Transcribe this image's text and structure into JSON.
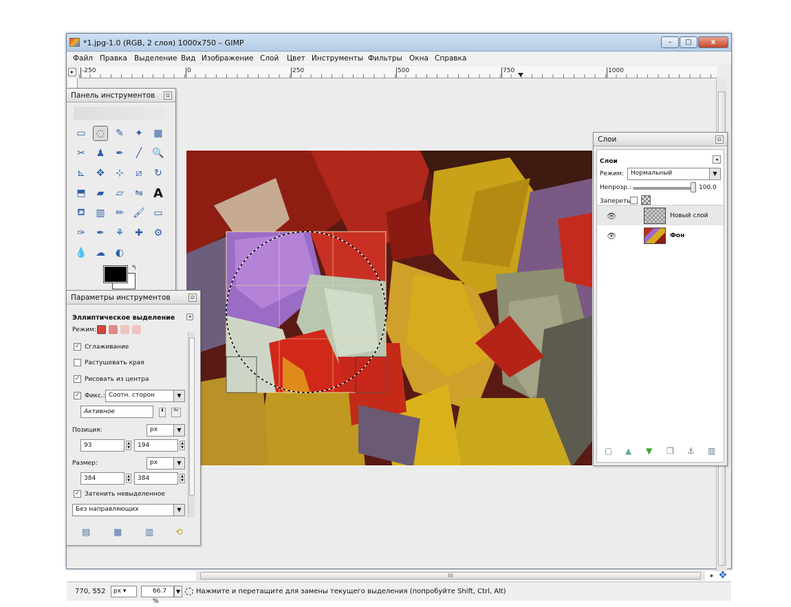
{
  "window": {
    "title": "*1.jpg-1.0 (RGB, 2 слоя) 1000x750 – GIMP",
    "min": "–",
    "max": "□",
    "close": "x"
  },
  "menu": [
    "Файл",
    "Правка",
    "Выделение",
    "Вид",
    "Изображение",
    "Слой",
    "Цвет",
    "Инструменты",
    "Фильтры",
    "Окна",
    "Справка"
  ],
  "ruler": {
    "corner": "▸",
    "labels": [
      "-250",
      "0",
      "250",
      "500",
      "750",
      "1000"
    ]
  },
  "toolbox": {
    "title": "Панель инструментов",
    "close": "⊡",
    "swap": "↰",
    "tools": [
      "rect-select",
      "ellipse-select",
      "free-select",
      "fuzzy-select",
      "color-select",
      "scissors",
      "foreground-select",
      "paths",
      "color-picker",
      "zoom",
      "measure",
      "move",
      "align",
      "crop",
      "rotate",
      "scale",
      "shear",
      "perspective",
      "flip",
      "text",
      "bucket-fill",
      "blend",
      "pencil",
      "paintbrush",
      "eraser",
      "airbrush",
      "ink",
      "clone",
      "heal",
      "perspective-clone",
      "blur",
      "smudge",
      "dodge-burn"
    ],
    "glyphs": [
      "▭",
      "◌",
      "✎",
      "✦",
      "▦",
      "✂",
      "♟",
      "✒",
      "╱",
      "🔍",
      "⊾",
      "✥",
      "⊹",
      "⧄",
      "↻",
      "⬒",
      "▰",
      "▱",
      "⇋",
      "A",
      "⛾",
      "▥",
      "✏",
      "🖌",
      "▭",
      "✑",
      "✒",
      "⚘",
      "✚",
      "⚙",
      "💧",
      "☁",
      "◐"
    ]
  },
  "tool_options": {
    "title": "Параметры инструментов",
    "close": "⊡",
    "header": "Эллиптическое выделение",
    "mode_label": "Режим:",
    "antialias": "Сглаживание",
    "feather": "Растушевать края",
    "from_center": "Рисовать из центра",
    "fixed": "Фикс.:",
    "fixed_value": "Соотн. сторон",
    "fixed_text": "Активное",
    "position_label": "Позиция:",
    "position_unit": "px",
    "position_x": "93",
    "position_y": "194",
    "size_label": "Размер:",
    "size_unit": "px",
    "size_w": "384",
    "size_h": "384",
    "highlight": "Затенить невыделенное",
    "guides": "Без направляющих",
    "check": "✓",
    "arrow": "▼"
  },
  "layers": {
    "title": "Слои",
    "close": "⊡",
    "subtitle": "Слои",
    "mode_label": "Режим:",
    "mode_value": "Нормальный",
    "opacity_label": "Непрозр.:",
    "opacity_value": "100.0",
    "lock_label": "Запереть:",
    "items": [
      {
        "name": "Новый слой"
      },
      {
        "name": "Фон"
      }
    ],
    "eye": "👁"
  },
  "status": {
    "coords": "770, 552",
    "unit": "px",
    "zoom": "66.7 %",
    "message": "Нажмите и перетащите для замены текущего выделения (попробуйте Shift, Ctrl, Alt)"
  },
  "colors": {
    "accent": "#2b5ea8",
    "titlebar": "#b5cde6"
  }
}
